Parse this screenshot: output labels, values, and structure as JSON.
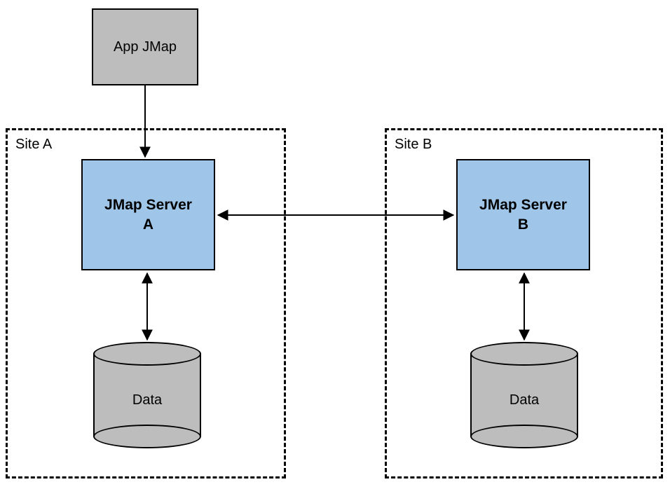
{
  "nodes": {
    "app": {
      "label": "App JMap"
    },
    "serverA": {
      "label": "JMap Server\nA"
    },
    "serverB": {
      "label": "JMap Server\nB"
    },
    "dataA": {
      "label": "Data"
    },
    "dataB": {
      "label": "Data"
    }
  },
  "groups": {
    "siteA": {
      "label": "Site A"
    },
    "siteB": {
      "label": "Site B"
    }
  },
  "edges": [
    {
      "from": "app",
      "to": "serverA",
      "bidirectional": false
    },
    {
      "from": "serverA",
      "to": "serverB",
      "bidirectional": true
    },
    {
      "from": "serverA",
      "to": "dataA",
      "bidirectional": true
    },
    {
      "from": "serverB",
      "to": "dataB",
      "bidirectional": true
    }
  ],
  "colors": {
    "server_fill": "#9fc5e8",
    "generic_fill": "#bdbdbd",
    "stroke": "#000000"
  }
}
